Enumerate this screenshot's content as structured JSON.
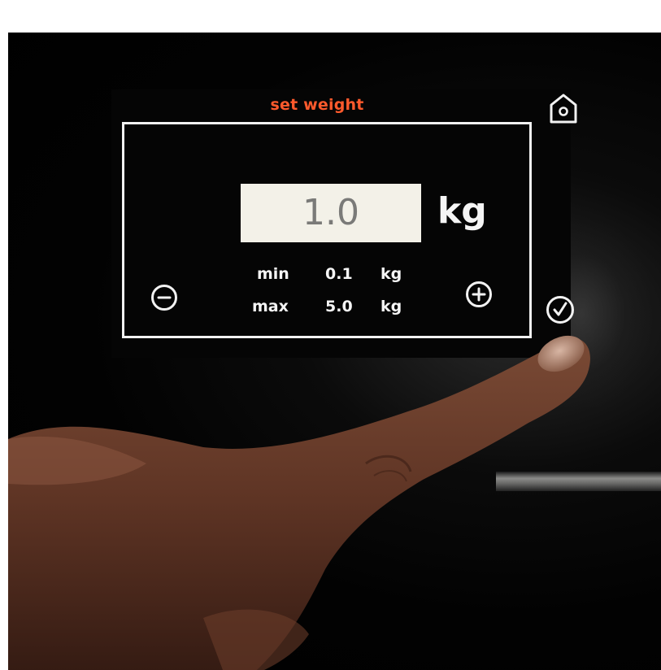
{
  "screen": {
    "title": "set weight",
    "value": "1.0",
    "unit": "kg",
    "min": {
      "label": "min",
      "value": "0.1",
      "unit": "kg"
    },
    "max": {
      "label": "max",
      "value": "5.0",
      "unit": "kg"
    }
  },
  "buttons": {
    "decrease_icon": "minus-circle-icon",
    "increase_icon": "plus-circle-icon",
    "confirm_icon": "check-circle-icon",
    "home_icon": "home-icon"
  },
  "colors": {
    "title": "#ff5a2c",
    "foreground": "#f2f2f2",
    "value_box": "#f3f1e8",
    "background": "#000000"
  }
}
